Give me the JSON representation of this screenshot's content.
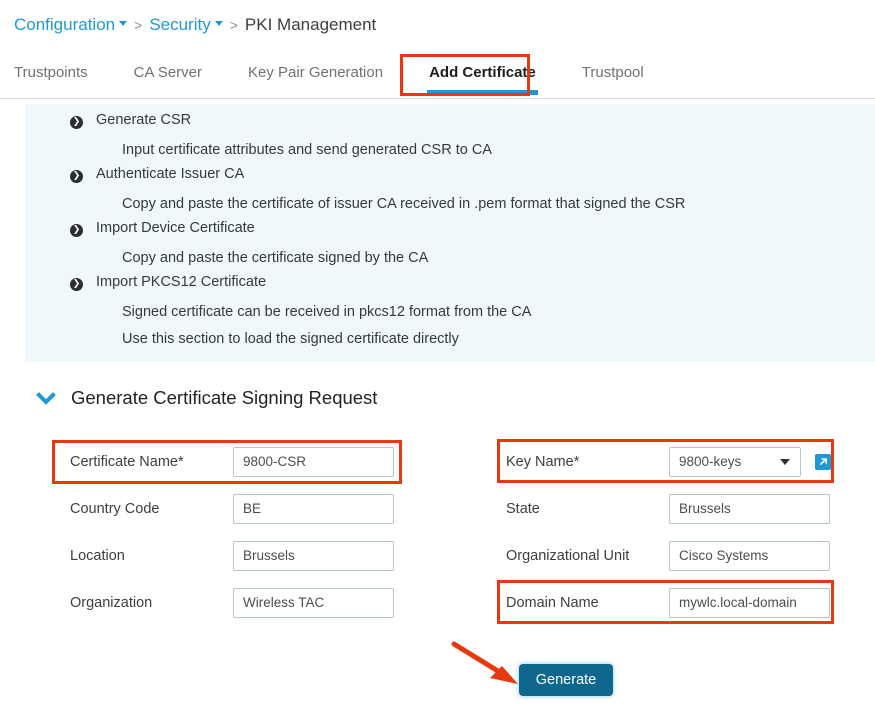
{
  "breadcrumb": {
    "items": [
      {
        "label": "Configuration",
        "has_caret": true,
        "link": true
      },
      {
        "label": "Security",
        "has_caret": true,
        "link": true
      },
      {
        "label": "PKI Management",
        "has_caret": false,
        "link": false
      }
    ],
    "separator": ">"
  },
  "tabs": [
    {
      "label": "Trustpoints",
      "active": false
    },
    {
      "label": "CA Server",
      "active": false
    },
    {
      "label": "Key Pair Generation",
      "active": false
    },
    {
      "label": "Add Certificate",
      "active": true
    },
    {
      "label": "Trustpool",
      "active": false
    }
  ],
  "info_panel": {
    "entries": [
      {
        "bullet_icon": "chevron-right-circle-icon",
        "title": "Generate CSR",
        "descriptions": [
          "Input certificate attributes and send generated CSR to CA"
        ]
      },
      {
        "bullet_icon": "chevron-right-circle-icon",
        "title": "Authenticate Issuer CA",
        "descriptions": [
          "Copy and paste the certificate of issuer CA received in .pem format that signed the CSR"
        ]
      },
      {
        "bullet_icon": "chevron-right-circle-icon",
        "title": "Import Device Certificate",
        "descriptions": [
          "Copy and paste the certificate signed by the CA"
        ]
      },
      {
        "bullet_icon": "chevron-right-circle-icon",
        "title": "Import PKCS12 Certificate",
        "descriptions": [
          "Signed certificate can be received in pkcs12 format from the CA",
          "Use this section to load the signed certificate directly"
        ]
      }
    ],
    "bullet_glyph": "❯"
  },
  "section": {
    "chevron_icon": "chevron-down-icon",
    "title": "Generate Certificate Signing Request",
    "expanded": true
  },
  "form": {
    "left_fields": [
      {
        "label": "Certificate Name*",
        "value": "9800-CSR",
        "type": "text",
        "highlighted": true
      },
      {
        "label": "Country Code",
        "value": "BE",
        "type": "text",
        "highlighted": false
      },
      {
        "label": "Location",
        "value": "Brussels",
        "type": "text",
        "highlighted": false
      },
      {
        "label": "Organization",
        "value": "Wireless TAC",
        "type": "text",
        "highlighted": false
      }
    ],
    "right_fields": [
      {
        "label": "Key Name*",
        "value": "9800-keys",
        "type": "select",
        "highlighted": true,
        "trailing_icon": "external-link-icon"
      },
      {
        "label": "State",
        "value": "Brussels",
        "type": "text",
        "highlighted": false
      },
      {
        "label": "Organizational Unit",
        "value": "Cisco Systems",
        "type": "text",
        "highlighted": false
      },
      {
        "label": "Domain Name",
        "value": "mywlc.local-domain",
        "type": "text",
        "highlighted": true
      }
    ]
  },
  "actions": {
    "generate_label": "Generate"
  },
  "colors": {
    "accent_blue": "#1d9ad6",
    "button_blue": "#10678e",
    "annotation_red": "#e8380d",
    "panel_background": "#eff9fc"
  }
}
